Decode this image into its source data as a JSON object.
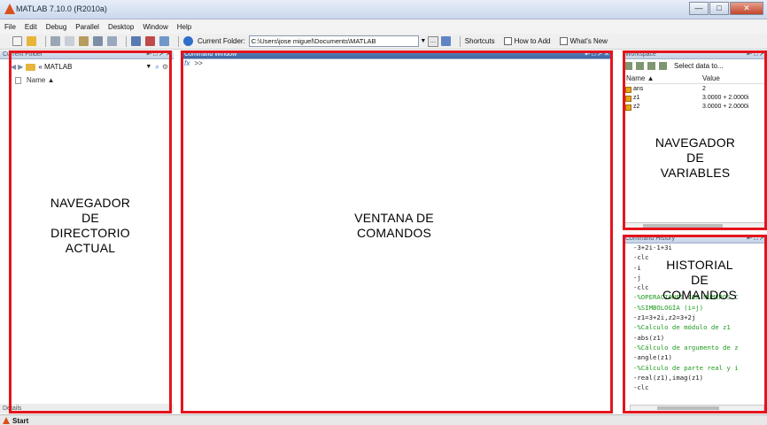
{
  "window": {
    "title": "MATLAB  7.10.0 (R2010a)",
    "buttons": [
      "—",
      "□",
      "✕"
    ]
  },
  "menu": [
    "File",
    "Edit",
    "Debug",
    "Parallel",
    "Desktop",
    "Window",
    "Help"
  ],
  "toolbar": {
    "current_folder_label": "Current Folder:",
    "current_folder_value": "C:\\Users\\jose miguel\\Documents\\MATLAB",
    "shortcuts_label": "Shortcuts",
    "how_to_add_label": "How to Add",
    "whats_new_label": "What's New"
  },
  "panels": {
    "current_folder": {
      "title": "Current Folder",
      "path": "« MATLAB",
      "column": "Name ▲",
      "details": "Details",
      "label": [
        "NAVEGADOR",
        "DE",
        "DIRECTORIO",
        "ACTUAL"
      ]
    },
    "command_window": {
      "title": "Command Window",
      "fx": "fx",
      "prompt": ">>",
      "label": [
        "VENTANA DE",
        "COMANDOS"
      ]
    },
    "workspace": {
      "title": "Workspace",
      "select_data": "Select data to...",
      "columns": [
        "Name ▲",
        "Value"
      ],
      "rows": [
        {
          "name": "ans",
          "value": "2"
        },
        {
          "name": "z1",
          "value": "3.0000 + 2.0000i"
        },
        {
          "name": "z2",
          "value": "3.0000 + 2.0000i"
        }
      ],
      "label": [
        "NAVEGADOR",
        "DE",
        "VARIABLES"
      ]
    },
    "command_history": {
      "title": "Command History",
      "lines": [
        {
          "text": "-3+2i-1+3i",
          "comment": false
        },
        {
          "text": "-clc",
          "comment": false
        },
        {
          "text": "-i",
          "comment": false
        },
        {
          "text": "-j",
          "comment": false
        },
        {
          "text": "-clc",
          "comment": false
        },
        {
          "text": "-%OPERACIONES CON NÚMEROS C",
          "comment": true
        },
        {
          "text": "-%SIMBOLOGÍA (i=j)",
          "comment": true
        },
        {
          "text": "-z1=3+2i,z2=3+2j",
          "comment": false
        },
        {
          "text": "-%Calculo de módulo de z1",
          "comment": true
        },
        {
          "text": "-abs(z1)",
          "comment": false
        },
        {
          "text": "-%Cálculo de argumento de z",
          "comment": true
        },
        {
          "text": "-angle(z1)",
          "comment": false
        },
        {
          "text": "-%Cálculo de parte real y i",
          "comment": true
        },
        {
          "text": "-real(z1),imag(z1)",
          "comment": false
        },
        {
          "text": "-clc",
          "comment": false
        }
      ],
      "label": [
        "HISTORIAL",
        "DE",
        "COMANDOS"
      ]
    }
  },
  "taskbar": {
    "start": "Start"
  },
  "colors": {
    "annotation_red": "#e4141c",
    "comment_green": "#1e9a1e",
    "active_header": "#3d66a4"
  }
}
